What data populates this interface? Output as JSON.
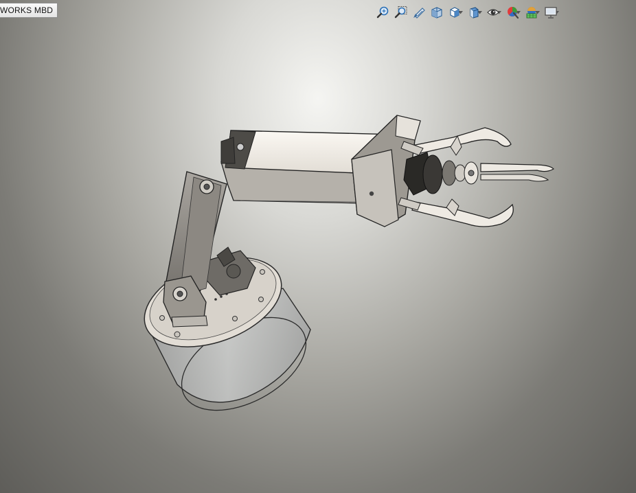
{
  "tabs": {
    "mbd_label": "WORKS MBD"
  },
  "toolbar": {
    "buttons": [
      {
        "name": "zoom-to-fit",
        "icon": "zoom-to-fit-icon"
      },
      {
        "name": "zoom-to-area",
        "icon": "zoom-to-area-icon"
      },
      {
        "name": "previous-view",
        "icon": "previous-view-icon"
      },
      {
        "name": "section-view",
        "icon": "section-view-icon"
      },
      {
        "name": "view-orientation",
        "icon": "view-orientation-icon"
      },
      {
        "name": "display-style",
        "icon": "display-style-icon"
      },
      {
        "name": "hide-show-items",
        "icon": "hide-show-items-icon"
      },
      {
        "name": "edit-appearance",
        "icon": "edit-appearance-icon"
      },
      {
        "name": "apply-scene",
        "icon": "apply-scene-icon"
      },
      {
        "name": "view-settings",
        "icon": "view-settings-icon"
      }
    ]
  },
  "colors": {
    "accent_blue": "#2a6fb5",
    "model_body": "#f0ebe3",
    "model_edge": "#2b2b2b",
    "model_shade": "#8a8782",
    "base_transparent": "#c9cbcd"
  }
}
